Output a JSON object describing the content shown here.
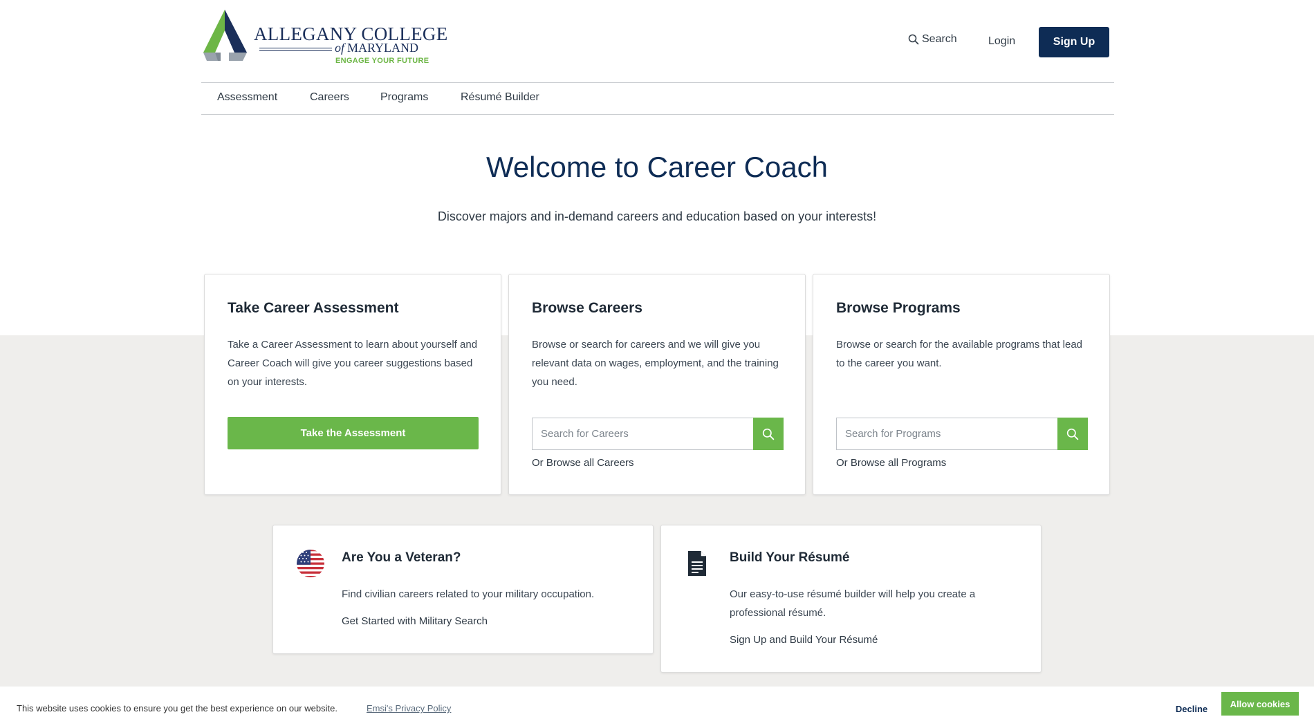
{
  "brand": {
    "name": "ALLEGANY COLLEGE",
    "sub_of": "of",
    "sub_state": "MARYLAND",
    "tagline": "ENGAGE YOUR FUTURE"
  },
  "header": {
    "search_label": "Search",
    "login_label": "Login",
    "signup_label": "Sign Up"
  },
  "nav": {
    "items": [
      "Assessment",
      "Careers",
      "Programs",
      "Résumé Builder"
    ]
  },
  "hero": {
    "title": "Welcome to Career Coach",
    "subtitle": "Discover majors and in-demand careers and education based on your interests!"
  },
  "cards": {
    "assessment": {
      "title": "Take Career Assessment",
      "text": "Take a Career Assessment to learn about yourself and Career Coach will give you career suggestions based on your interests.",
      "button": "Take the Assessment"
    },
    "careers": {
      "title": "Browse Careers",
      "text": "Browse or search for careers and we will give you relevant data on wages, employment, and the training you need.",
      "placeholder": "Search for Careers",
      "link": "Or Browse all Careers"
    },
    "programs": {
      "title": "Browse Programs",
      "text": "Browse or search for the available programs that lead to the career you want.",
      "placeholder": "Search for Programs",
      "link": "Or Browse all Programs"
    },
    "veteran": {
      "title": "Are You a Veteran?",
      "text": "Find civilian careers related to your military occupation.",
      "link": "Get Started with Military Search"
    },
    "resume": {
      "title": "Build Your Résumé",
      "text": "Our easy-to-use résumé builder will help you create a professional résumé.",
      "link": "Sign Up and Build Your Résumé"
    }
  },
  "cookie": {
    "text": "This website uses cookies to ensure you get the best experience on our website.",
    "policy_link": "Emsi's Privacy Policy",
    "decline": "Decline",
    "allow": "Allow cookies"
  },
  "colors": {
    "navy": "#0e2c55",
    "green": "#6ab74a",
    "gray_band": "#efeeec"
  },
  "icons": {
    "search": "search-icon",
    "flag": "us-flag-icon",
    "document": "document-icon"
  }
}
